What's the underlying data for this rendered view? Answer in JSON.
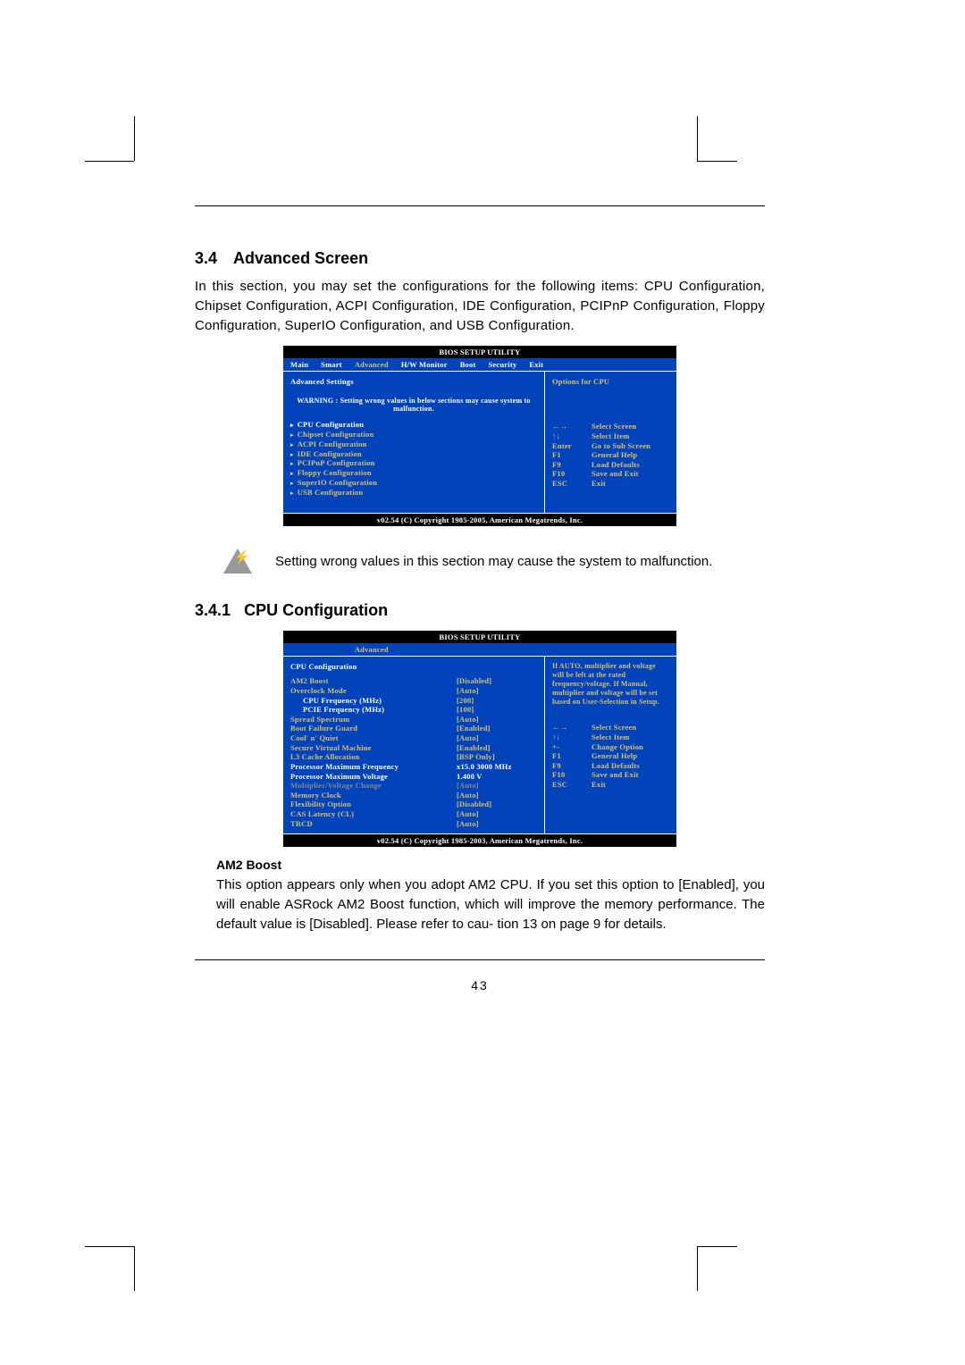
{
  "page_number": "43",
  "section": {
    "num": "3.4",
    "title": "Advanced Screen"
  },
  "intro_text": "In this section, you may set the configurations for the following items: CPU Configuration, Chipset Configuration, ACPI Configuration, IDE Configuration, PCIPnP Configuration, Floppy Configuration, SuperIO Configuration, and USB Configuration.",
  "bios1": {
    "title": "BIOS SETUP UTILITY",
    "tabs": [
      "Main",
      "Smart",
      "Advanced",
      "H/W Monitor",
      "Boot",
      "Security",
      "Exit"
    ],
    "active_tab_index": 2,
    "panel_title": "Advanced Settings",
    "warning": "WARNING :  Setting wrong values in below sections may cause system to malfunction.",
    "items": [
      "CPU Configuration",
      "Chipset Configuration",
      "ACPI Configuration",
      "IDE Configuration",
      "PCIPnP Configuration",
      "Floppy Configuration",
      "SuperIO Configuration",
      "USB Configuration"
    ],
    "right_hint": "Options for CPU",
    "keys": [
      {
        "k": "←→",
        "d": "Select Screen"
      },
      {
        "k": "↑↓",
        "d": "Select Item"
      },
      {
        "k": "Enter",
        "d": "Go to Sub Screen"
      },
      {
        "k": "F1",
        "d": "General Help"
      },
      {
        "k": "F9",
        "d": "Load Defaults"
      },
      {
        "k": "F10",
        "d": "Save and Exit"
      },
      {
        "k": "ESC",
        "d": "Exit"
      }
    ],
    "copyright": "v02.54 (C) Copyright 1985-2005, American Megatrends, Inc."
  },
  "note_text": "Setting wrong values in this section may cause the system to malfunction.",
  "subsection": {
    "num": "3.4.1",
    "title": "CPU Configuration"
  },
  "bios2": {
    "title": "BIOS SETUP UTILITY",
    "tab": "Advanced",
    "panel_title": "CPU Configuration",
    "rows": [
      {
        "k": "AM2 Boost",
        "v": "[Disabled]",
        "style": "normal"
      },
      {
        "k": "Overclock Mode",
        "v": "[Auto]",
        "style": "normal"
      },
      {
        "k": "CPU Frequency (MHz)",
        "v": "[200]",
        "style": "indent"
      },
      {
        "k": "PCIE Frequency (MHz)",
        "v": "[100]",
        "style": "indent"
      },
      {
        "k": "Spread Spectrum",
        "v": "[Auto]",
        "style": "normal"
      },
      {
        "k": "Boot Failure Guard",
        "v": "[Enabled]",
        "style": "normal"
      },
      {
        "k": "Cool' n' Quiet",
        "v": "[Auto]",
        "style": "normal"
      },
      {
        "k": "Secure Virtual Machine",
        "v": "[Enabled]",
        "style": "normal"
      },
      {
        "k": "L3 Cache Allocation",
        "v": "[BSP Only]",
        "style": "normal"
      },
      {
        "k": "Processor Maximum Frequency",
        "v": "x15.0 3000 MHz",
        "style": "plain"
      },
      {
        "k": "Processor Maximum Voltage",
        "v": "1.400 V",
        "style": "plain"
      },
      {
        "k": "Multiplier/Voltage Change",
        "v": "[Auto]",
        "style": "dim"
      },
      {
        "k": "Memory Clock",
        "v": "[Auto]",
        "style": "normal"
      },
      {
        "k": "Flexibility Option",
        "v": "[Disabled]",
        "style": "normal"
      },
      {
        "k": "CAS Latency (CL)",
        "v": "[Auto]",
        "style": "normal"
      },
      {
        "k": "TRCD",
        "v": "[Auto]",
        "style": "normal"
      }
    ],
    "right_text": "If AUTO, multiplier and voltage will be left at the rated frequency/voltage. If Manual, multiplier and voltage will be set based on User-Selection in Setup.",
    "keys": [
      {
        "k": "←→",
        "d": "Select Screen"
      },
      {
        "k": "↑↓",
        "d": "Select Item"
      },
      {
        "k": "+-",
        "d": "Change Option"
      },
      {
        "k": "F1",
        "d": "General Help"
      },
      {
        "k": "F9",
        "d": "Load Defaults"
      },
      {
        "k": "F10",
        "d": "Save and Exit"
      },
      {
        "k": "ESC",
        "d": "Exit"
      }
    ],
    "copyright": "v02.54 (C) Copyright 1985-2003, American Megatrends, Inc."
  },
  "am2": {
    "heading": "AM2 Boost",
    "body": "This option appears only when you adopt AM2 CPU. If you set this option to [Enabled], you will enable ASRock AM2 Boost function, which will improve the memory performance. The default value is [Disabled]. Please refer to cau- tion 13 on page 9 for details."
  }
}
